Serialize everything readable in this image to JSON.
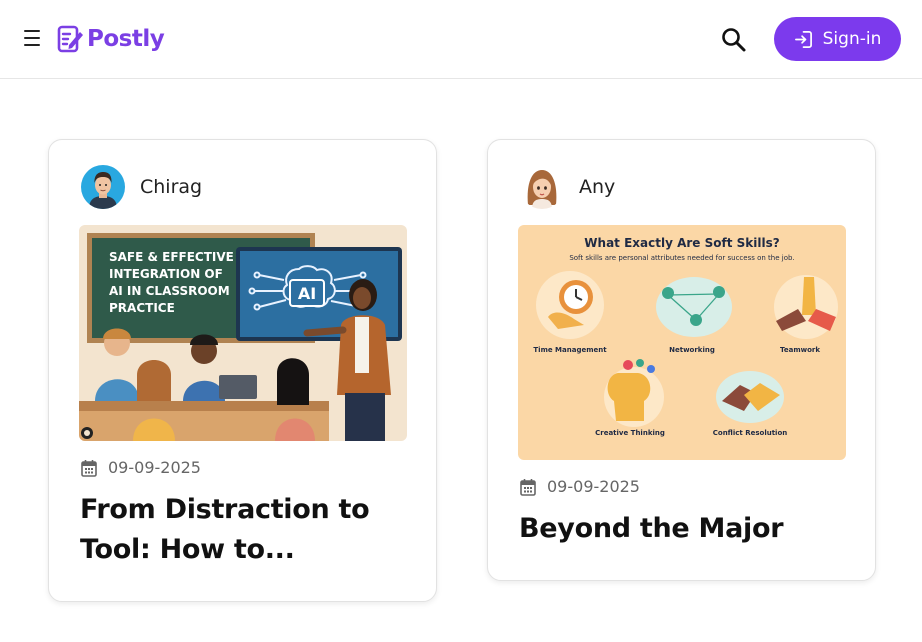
{
  "header": {
    "brand": "Postly",
    "signin_label": "Sign-in",
    "accent_color": "#7c3aed"
  },
  "posts": [
    {
      "author": "Chirag",
      "date": "09-09-2025",
      "title": "From Distraction to Tool: How to...",
      "image": {
        "headline_lines": [
          "SAFE & EFFECTIVE",
          "INTEGRATION OF",
          "AI IN CLASSROOM",
          "PRACTICE"
        ],
        "screen_label": "AI"
      }
    },
    {
      "author": "Any",
      "date": "09-09-2025",
      "title": "Beyond the Major",
      "image": {
        "heading": "What Exactly Are Soft Skills?",
        "subheading": "Soft skills are personal attributes needed for success on the job.",
        "skills": [
          "Time Management",
          "Networking",
          "Teamwork",
          "Creative Thinking",
          "Conflict Resolution"
        ]
      }
    }
  ]
}
